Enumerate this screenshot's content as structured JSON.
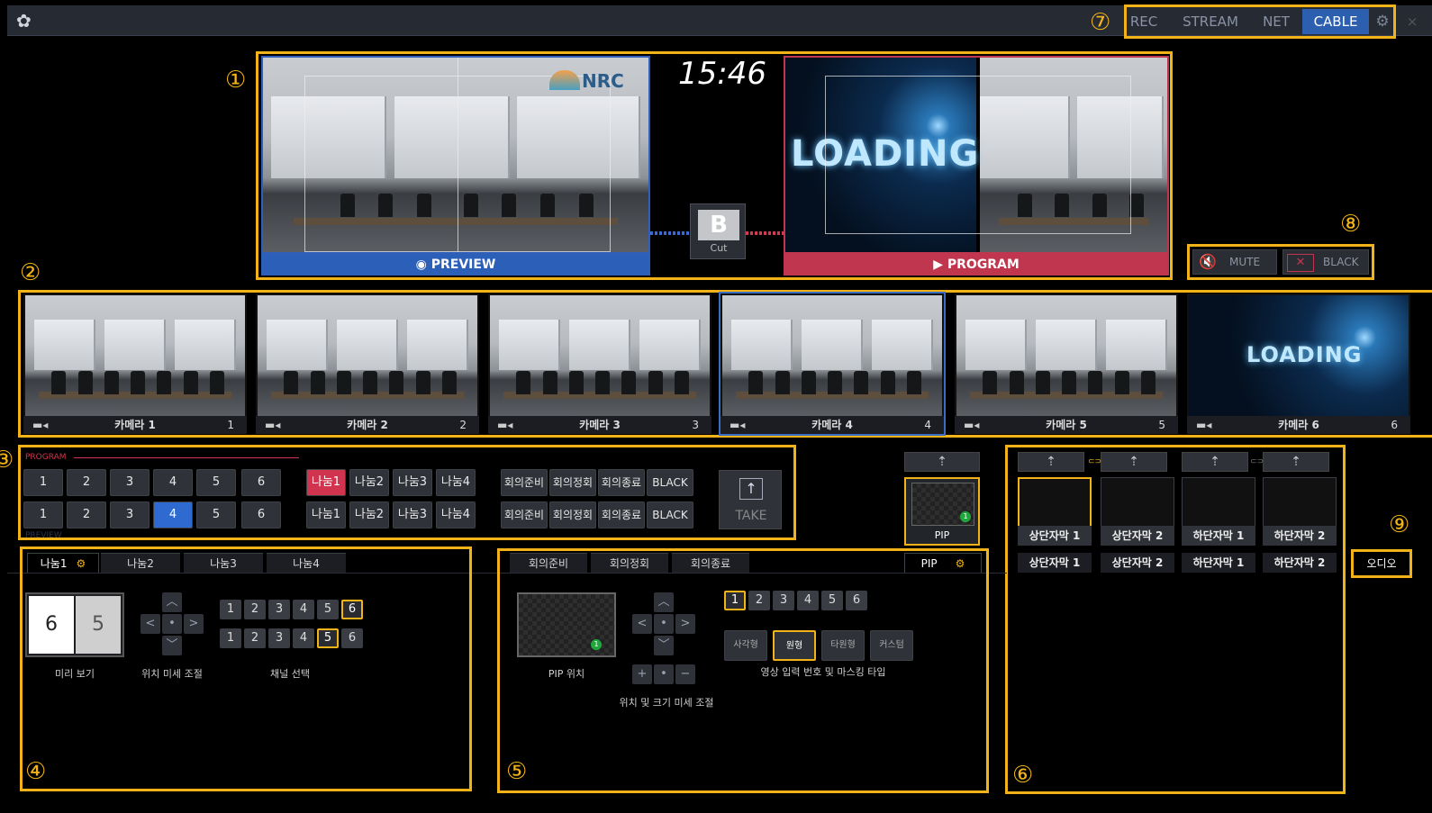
{
  "topbar": {
    "logo": "✿",
    "buttons": [
      "REC",
      "STREAM",
      "NET",
      "CABLE"
    ],
    "active": "CABLE",
    "settings_icon": "gear-icon",
    "close": "×"
  },
  "annotations": [
    "①",
    "②",
    "③",
    "④",
    "⑤",
    "⑥",
    "⑦",
    "⑧",
    "⑨"
  ],
  "monitor": {
    "clock": "15:46",
    "preview_label": "PREVIEW",
    "program_label": "PROGRAM",
    "preview_logo": "NRC",
    "program_overlay": "LOADING",
    "transition_key": "B",
    "transition_label": "Cut"
  },
  "audio_controls": {
    "mute": "MUTE",
    "black": "BLACK"
  },
  "cameras": [
    {
      "name": "카메라 1",
      "num": "1"
    },
    {
      "name": "카메라 2",
      "num": "2"
    },
    {
      "name": "카메라 3",
      "num": "3"
    },
    {
      "name": "카메라 4",
      "num": "4"
    },
    {
      "name": "카메라 5",
      "num": "5"
    },
    {
      "name": "카메라 6",
      "num": "6"
    }
  ],
  "camera6_overlay": "LOADING",
  "switcher": {
    "program_title": "PROGRAM",
    "preview_title": "PREVIEW",
    "numbers": [
      "1",
      "2",
      "3",
      "4",
      "5",
      "6"
    ],
    "split": [
      "나눔1",
      "나눔2",
      "나눔3",
      "나눔4"
    ],
    "scenes": [
      "회의준비",
      "회의정회",
      "회의종료",
      "BLACK"
    ],
    "take": "TAKE",
    "program_active_split": "나눔1",
    "preview_active_number": "4"
  },
  "pip_button": {
    "label": "PIP",
    "dot": "1"
  },
  "captions": {
    "labels": [
      "상단자막 1",
      "상단자막 2",
      "하단자막 1",
      "하단자막 2"
    ],
    "link_icon": "⊂⊃"
  },
  "audio_tab": "오디오",
  "split_panel": {
    "tabs": [
      "나눔1",
      "나눔2",
      "나눔3",
      "나눔4"
    ],
    "preview_left": "6",
    "preview_right": "5",
    "preview_label": "미리 보기",
    "position_label": "위치 미세 조절",
    "channel_label": "채널 선택",
    "row1": [
      "1",
      "2",
      "3",
      "4",
      "5",
      "6"
    ],
    "row2": [
      "1",
      "2",
      "3",
      "4",
      "5",
      "6"
    ],
    "row1_selected": "6",
    "row2_selected": "5"
  },
  "pip_panel": {
    "tabs": [
      "회의준비",
      "회의정회",
      "회의종료"
    ],
    "pip_tab": "PIP",
    "pip_position_label": "PIP 위치",
    "size_label": "위치 및 크기 미세 조절",
    "inputs": [
      "1",
      "2",
      "3",
      "4",
      "5",
      "6"
    ],
    "selected_input": "1",
    "mask_types": [
      "사각형",
      "원형",
      "타원형",
      "커스텀"
    ],
    "selected_mask": "원형",
    "mask_label": "영상 입력 번호 및 마스킹 타입",
    "dot": "1"
  }
}
